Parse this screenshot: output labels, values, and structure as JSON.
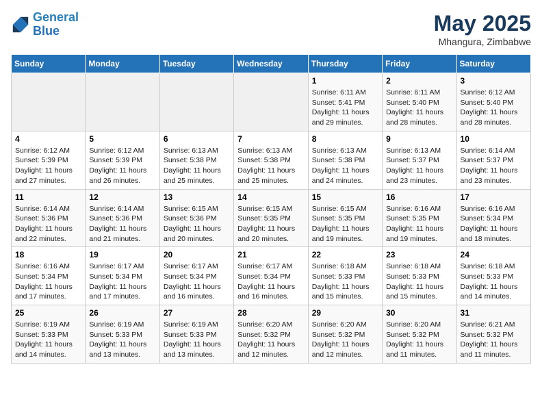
{
  "header": {
    "logo_line1": "General",
    "logo_line2": "Blue",
    "month": "May 2025",
    "location": "Mhangura, Zimbabwe"
  },
  "weekdays": [
    "Sunday",
    "Monday",
    "Tuesday",
    "Wednesday",
    "Thursday",
    "Friday",
    "Saturday"
  ],
  "weeks": [
    [
      {
        "day": "",
        "info": ""
      },
      {
        "day": "",
        "info": ""
      },
      {
        "day": "",
        "info": ""
      },
      {
        "day": "",
        "info": ""
      },
      {
        "day": "1",
        "info": "Sunrise: 6:11 AM\nSunset: 5:41 PM\nDaylight: 11 hours\nand 29 minutes."
      },
      {
        "day": "2",
        "info": "Sunrise: 6:11 AM\nSunset: 5:40 PM\nDaylight: 11 hours\nand 28 minutes."
      },
      {
        "day": "3",
        "info": "Sunrise: 6:12 AM\nSunset: 5:40 PM\nDaylight: 11 hours\nand 28 minutes."
      }
    ],
    [
      {
        "day": "4",
        "info": "Sunrise: 6:12 AM\nSunset: 5:39 PM\nDaylight: 11 hours\nand 27 minutes."
      },
      {
        "day": "5",
        "info": "Sunrise: 6:12 AM\nSunset: 5:39 PM\nDaylight: 11 hours\nand 26 minutes."
      },
      {
        "day": "6",
        "info": "Sunrise: 6:13 AM\nSunset: 5:38 PM\nDaylight: 11 hours\nand 25 minutes."
      },
      {
        "day": "7",
        "info": "Sunrise: 6:13 AM\nSunset: 5:38 PM\nDaylight: 11 hours\nand 25 minutes."
      },
      {
        "day": "8",
        "info": "Sunrise: 6:13 AM\nSunset: 5:38 PM\nDaylight: 11 hours\nand 24 minutes."
      },
      {
        "day": "9",
        "info": "Sunrise: 6:13 AM\nSunset: 5:37 PM\nDaylight: 11 hours\nand 23 minutes."
      },
      {
        "day": "10",
        "info": "Sunrise: 6:14 AM\nSunset: 5:37 PM\nDaylight: 11 hours\nand 23 minutes."
      }
    ],
    [
      {
        "day": "11",
        "info": "Sunrise: 6:14 AM\nSunset: 5:36 PM\nDaylight: 11 hours\nand 22 minutes."
      },
      {
        "day": "12",
        "info": "Sunrise: 6:14 AM\nSunset: 5:36 PM\nDaylight: 11 hours\nand 21 minutes."
      },
      {
        "day": "13",
        "info": "Sunrise: 6:15 AM\nSunset: 5:36 PM\nDaylight: 11 hours\nand 20 minutes."
      },
      {
        "day": "14",
        "info": "Sunrise: 6:15 AM\nSunset: 5:35 PM\nDaylight: 11 hours\nand 20 minutes."
      },
      {
        "day": "15",
        "info": "Sunrise: 6:15 AM\nSunset: 5:35 PM\nDaylight: 11 hours\nand 19 minutes."
      },
      {
        "day": "16",
        "info": "Sunrise: 6:16 AM\nSunset: 5:35 PM\nDaylight: 11 hours\nand 19 minutes."
      },
      {
        "day": "17",
        "info": "Sunrise: 6:16 AM\nSunset: 5:34 PM\nDaylight: 11 hours\nand 18 minutes."
      }
    ],
    [
      {
        "day": "18",
        "info": "Sunrise: 6:16 AM\nSunset: 5:34 PM\nDaylight: 11 hours\nand 17 minutes."
      },
      {
        "day": "19",
        "info": "Sunrise: 6:17 AM\nSunset: 5:34 PM\nDaylight: 11 hours\nand 17 minutes."
      },
      {
        "day": "20",
        "info": "Sunrise: 6:17 AM\nSunset: 5:34 PM\nDaylight: 11 hours\nand 16 minutes."
      },
      {
        "day": "21",
        "info": "Sunrise: 6:17 AM\nSunset: 5:34 PM\nDaylight: 11 hours\nand 16 minutes."
      },
      {
        "day": "22",
        "info": "Sunrise: 6:18 AM\nSunset: 5:33 PM\nDaylight: 11 hours\nand 15 minutes."
      },
      {
        "day": "23",
        "info": "Sunrise: 6:18 AM\nSunset: 5:33 PM\nDaylight: 11 hours\nand 15 minutes."
      },
      {
        "day": "24",
        "info": "Sunrise: 6:18 AM\nSunset: 5:33 PM\nDaylight: 11 hours\nand 14 minutes."
      }
    ],
    [
      {
        "day": "25",
        "info": "Sunrise: 6:19 AM\nSunset: 5:33 PM\nDaylight: 11 hours\nand 14 minutes."
      },
      {
        "day": "26",
        "info": "Sunrise: 6:19 AM\nSunset: 5:33 PM\nDaylight: 11 hours\nand 13 minutes."
      },
      {
        "day": "27",
        "info": "Sunrise: 6:19 AM\nSunset: 5:33 PM\nDaylight: 11 hours\nand 13 minutes."
      },
      {
        "day": "28",
        "info": "Sunrise: 6:20 AM\nSunset: 5:32 PM\nDaylight: 11 hours\nand 12 minutes."
      },
      {
        "day": "29",
        "info": "Sunrise: 6:20 AM\nSunset: 5:32 PM\nDaylight: 11 hours\nand 12 minutes."
      },
      {
        "day": "30",
        "info": "Sunrise: 6:20 AM\nSunset: 5:32 PM\nDaylight: 11 hours\nand 11 minutes."
      },
      {
        "day": "31",
        "info": "Sunrise: 6:21 AM\nSunset: 5:32 PM\nDaylight: 11 hours\nand 11 minutes."
      }
    ]
  ]
}
